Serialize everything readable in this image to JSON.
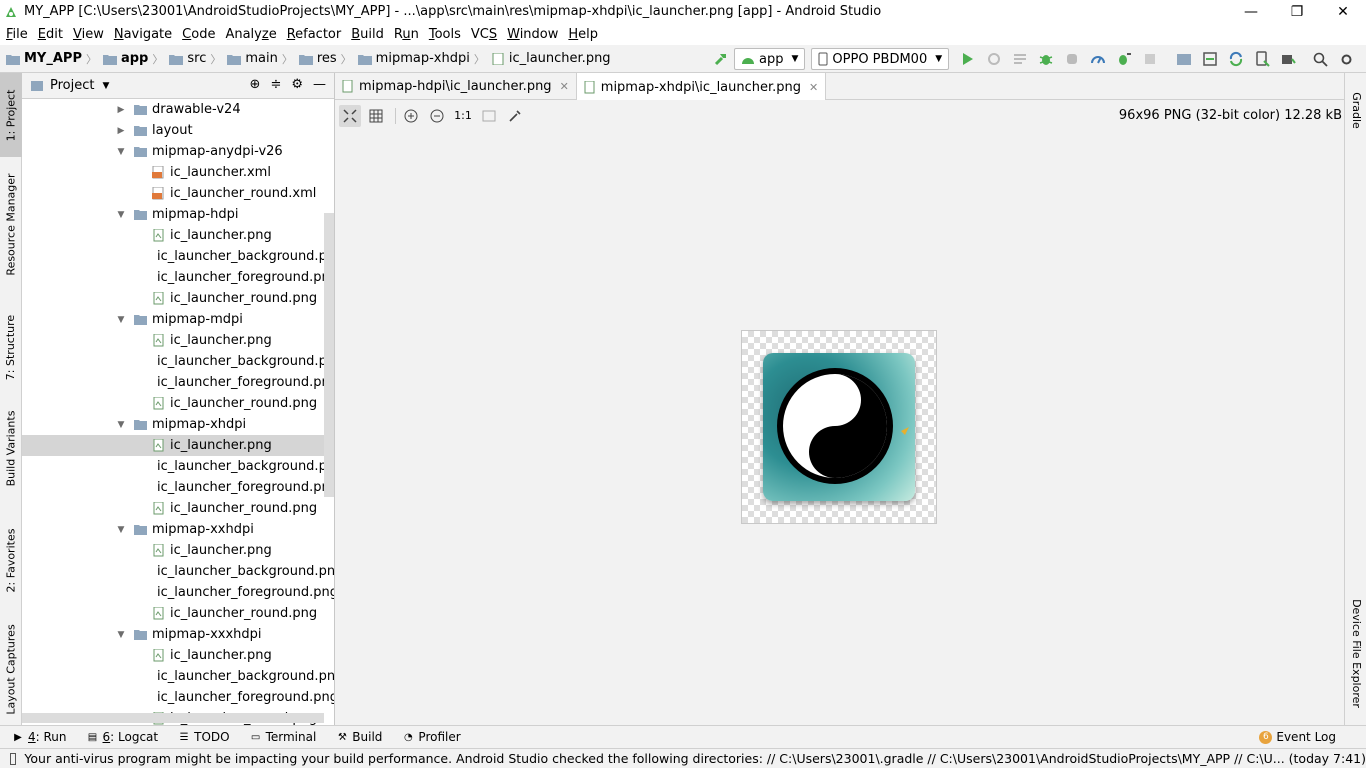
{
  "window": {
    "title": "MY_APP [C:\\Users\\23001\\AndroidStudioProjects\\MY_APP] - ...\\app\\src\\main\\res\\mipmap-xhdpi\\ic_launcher.png [app] - Android Studio",
    "minimize": "—",
    "restore": "❐",
    "close": "✕"
  },
  "menu": [
    {
      "mn": "F",
      "rest": "ile"
    },
    {
      "mn": "E",
      "rest": "dit"
    },
    {
      "mn": "V",
      "rest": "iew"
    },
    {
      "mn": "N",
      "rest": "avigate"
    },
    {
      "mn": "C",
      "rest": "ode"
    },
    {
      "pre": "Analy",
      "mn": "z",
      "rest": "e"
    },
    {
      "mn": "R",
      "rest": "efactor"
    },
    {
      "mn": "B",
      "rest": "uild"
    },
    {
      "pre": "R",
      "mn": "u",
      "rest": "n"
    },
    {
      "mn": "T",
      "rest": "ools"
    },
    {
      "pre": "VC",
      "mn": "S",
      "rest": ""
    },
    {
      "mn": "W",
      "rest": "indow"
    },
    {
      "mn": "H",
      "rest": "elp"
    }
  ],
  "breadcrumb": [
    "MY_APP",
    "app",
    "src",
    "main",
    "res",
    "mipmap-xhdpi",
    "ic_launcher.png"
  ],
  "toolbar": {
    "config": "app",
    "device": "OPPO PBDM00"
  },
  "project_panel": {
    "title": "Project",
    "tree": [
      {
        "label": "drawable-v24",
        "type": "folder",
        "indent": 0,
        "expanded": false
      },
      {
        "label": "layout",
        "type": "folder",
        "indent": 0,
        "expanded": false
      },
      {
        "label": "mipmap-anydpi-v26",
        "type": "folder",
        "indent": 0,
        "expanded": true
      },
      {
        "label": "ic_launcher.xml",
        "type": "xml",
        "indent": 1
      },
      {
        "label": "ic_launcher_round.xml",
        "type": "xml",
        "indent": 1
      },
      {
        "label": "mipmap-hdpi",
        "type": "folder",
        "indent": 0,
        "expanded": true
      },
      {
        "label": "ic_launcher.png",
        "type": "png",
        "indent": 1
      },
      {
        "label": "ic_launcher_background.png",
        "type": "png",
        "indent": 1
      },
      {
        "label": "ic_launcher_foreground.png",
        "type": "png",
        "indent": 1
      },
      {
        "label": "ic_launcher_round.png",
        "type": "png",
        "indent": 1
      },
      {
        "label": "mipmap-mdpi",
        "type": "folder",
        "indent": 0,
        "expanded": true
      },
      {
        "label": "ic_launcher.png",
        "type": "png",
        "indent": 1
      },
      {
        "label": "ic_launcher_background.png",
        "type": "png",
        "indent": 1
      },
      {
        "label": "ic_launcher_foreground.png",
        "type": "png",
        "indent": 1
      },
      {
        "label": "ic_launcher_round.png",
        "type": "png",
        "indent": 1
      },
      {
        "label": "mipmap-xhdpi",
        "type": "folder",
        "indent": 0,
        "expanded": true
      },
      {
        "label": "ic_launcher.png",
        "type": "png",
        "indent": 1,
        "selected": true
      },
      {
        "label": "ic_launcher_background.png",
        "type": "png",
        "indent": 1
      },
      {
        "label": "ic_launcher_foreground.png",
        "type": "png",
        "indent": 1
      },
      {
        "label": "ic_launcher_round.png",
        "type": "png",
        "indent": 1
      },
      {
        "label": "mipmap-xxhdpi",
        "type": "folder",
        "indent": 0,
        "expanded": true
      },
      {
        "label": "ic_launcher.png",
        "type": "png",
        "indent": 1
      },
      {
        "label": "ic_launcher_background.png",
        "type": "png",
        "indent": 1
      },
      {
        "label": "ic_launcher_foreground.png",
        "type": "png",
        "indent": 1
      },
      {
        "label": "ic_launcher_round.png",
        "type": "png",
        "indent": 1
      },
      {
        "label": "mipmap-xxxhdpi",
        "type": "folder",
        "indent": 0,
        "expanded": true
      },
      {
        "label": "ic_launcher.png",
        "type": "png",
        "indent": 1
      },
      {
        "label": "ic_launcher_background.png",
        "type": "png",
        "indent": 1
      },
      {
        "label": "ic_launcher_foreground.png",
        "type": "png",
        "indent": 1
      },
      {
        "label": "ic_launcher_round.png",
        "type": "png",
        "indent": 1
      }
    ]
  },
  "left_tabs": [
    "1: Project",
    "Resource Manager",
    "7: Structure",
    "Build Variants",
    "2: Favorites",
    "Layout Captures"
  ],
  "right_tabs": [
    "Gradle",
    "Device File Explorer"
  ],
  "editor_tabs": [
    {
      "label": "mipmap-hdpi\\ic_launcher.png",
      "active": false
    },
    {
      "label": "mipmap-xhdpi\\ic_launcher.png",
      "active": true
    }
  ],
  "image_toolbar": {
    "actual_size": "1:1",
    "info": "96x96 PNG (32-bit color) 12.28 kB"
  },
  "bottom_tools": [
    {
      "mn": "4",
      "rest": ": Run",
      "icon": "run-icon"
    },
    {
      "mn": "6",
      "rest": ": Logcat",
      "icon": "logcat-icon"
    },
    {
      "mn": "",
      "rest": "TODO",
      "icon": "todo-icon"
    },
    {
      "mn": "",
      "rest": "Terminal",
      "icon": "terminal-icon"
    },
    {
      "mn": "",
      "rest": "Build",
      "icon": "build-icon"
    },
    {
      "mn": "",
      "rest": "Profiler",
      "icon": "profiler-icon"
    }
  ],
  "event_log": {
    "count": "6",
    "label": "Event Log"
  },
  "status": "Your anti-virus program might be impacting your build performance. Android Studio checked the following directories: // C:\\Users\\23001\\.gradle // C:\\Users\\23001\\AndroidStudioProjects\\MY_APP // C:\\U... (today 7:41)",
  "colors": {
    "accent_green": "#4caf50",
    "folder": "#8fa6bd",
    "selection": "#d5d5d5",
    "badge": "#e8a33d"
  }
}
